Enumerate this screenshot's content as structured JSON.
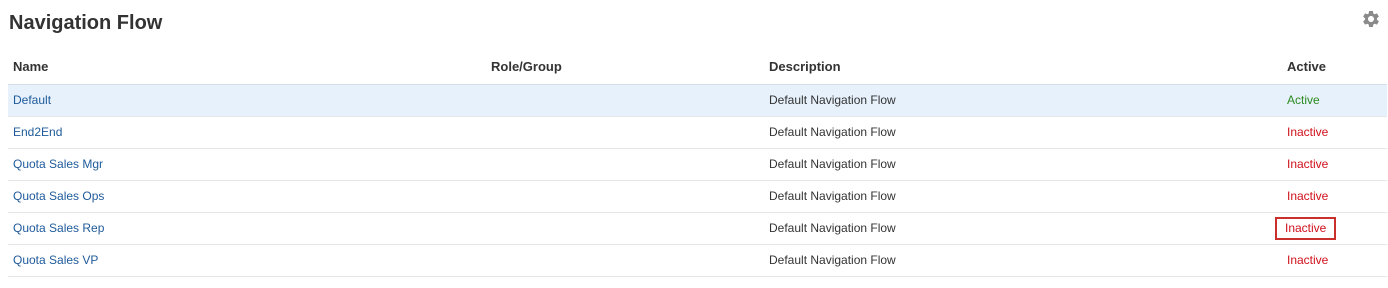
{
  "page": {
    "title": "Navigation Flow",
    "settings_icon": "gear-icon"
  },
  "table": {
    "columns": [
      "Name",
      "Role/Group",
      "Description",
      "Active"
    ],
    "rows": [
      {
        "name": "Default",
        "role": "",
        "description": "Default Navigation Flow",
        "active": "Active",
        "selected": true
      },
      {
        "name": "End2End",
        "role": "",
        "description": "Default Navigation Flow",
        "active": "Inactive"
      },
      {
        "name": "Quota Sales Mgr",
        "role": "",
        "description": "Default Navigation Flow",
        "active": "Inactive"
      },
      {
        "name": "Quota Sales Ops",
        "role": "",
        "description": "Default Navigation Flow",
        "active": "Inactive"
      },
      {
        "name": "Quota Sales Rep",
        "role": "",
        "description": "Default Navigation Flow",
        "active": "Inactive",
        "highlighted": true
      },
      {
        "name": "Quota Sales VP",
        "role": "",
        "description": "Default Navigation Flow",
        "active": "Inactive"
      }
    ]
  },
  "colors": {
    "link": "#1f5a9a",
    "active": "#2b8a1e",
    "inactive": "#d0101b",
    "selected_row": "#e6f1fb",
    "highlight_border": "#c9302c"
  }
}
